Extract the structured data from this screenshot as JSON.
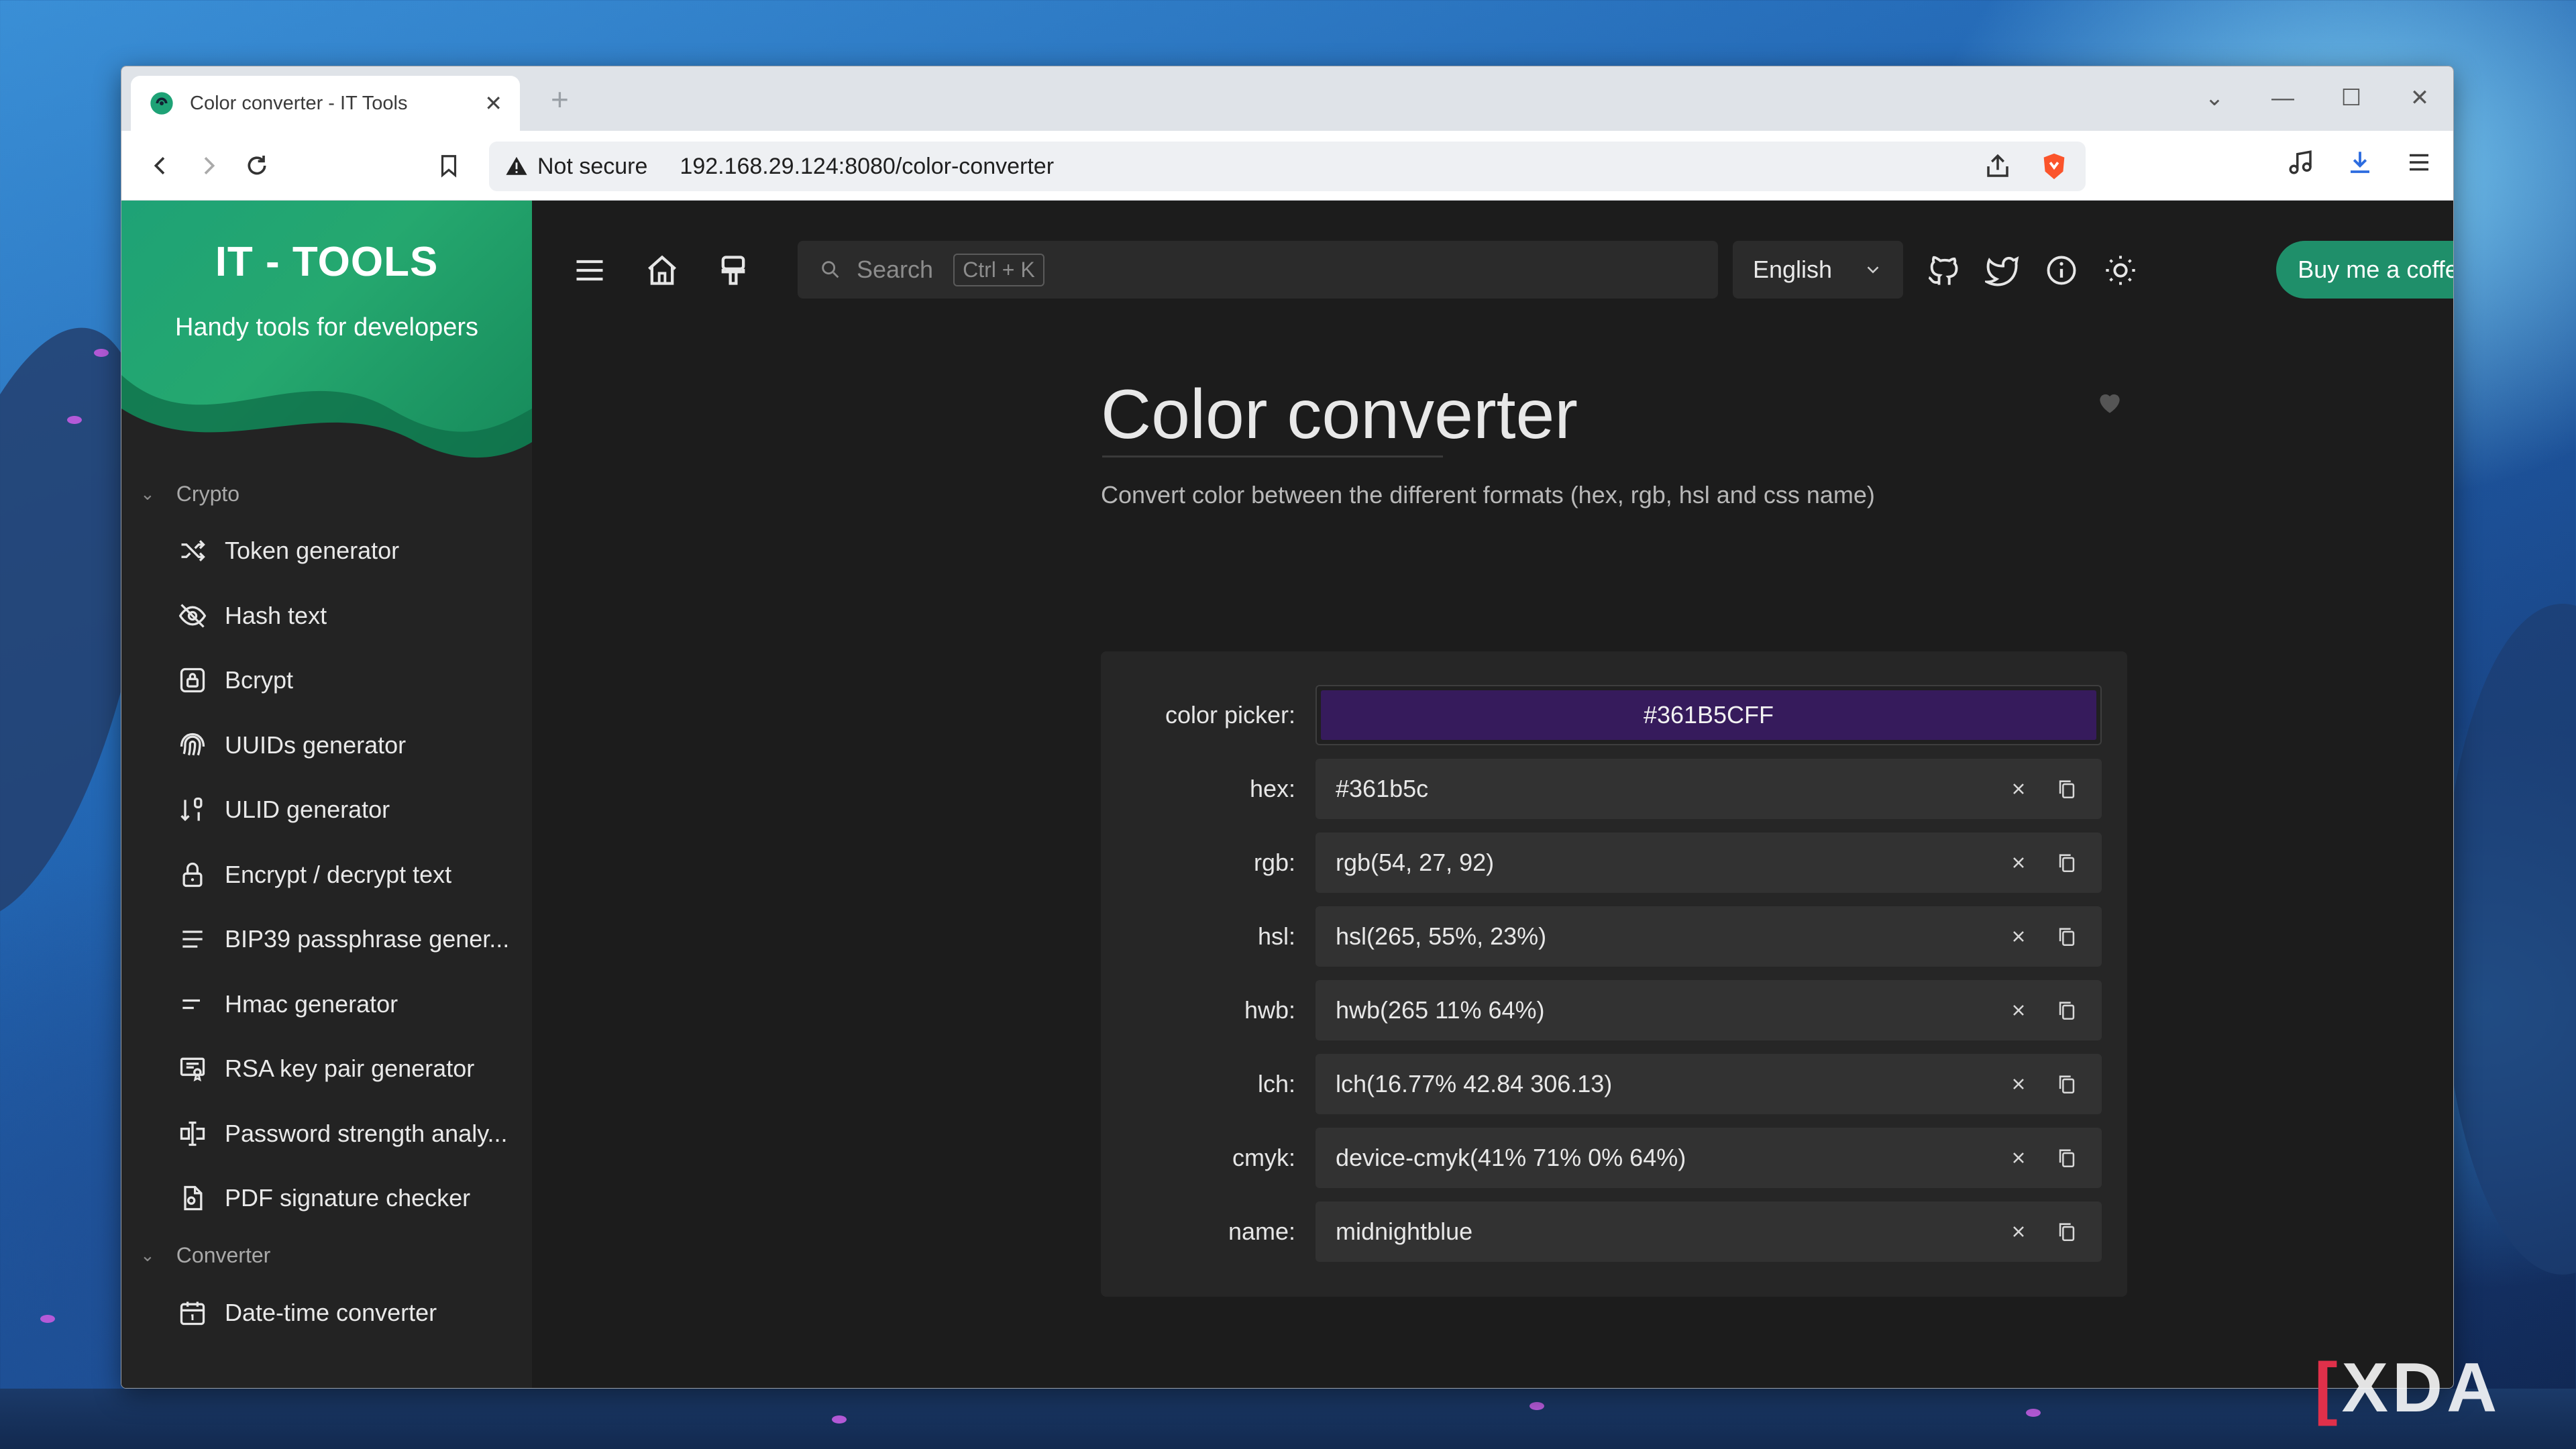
{
  "browser": {
    "tab_title": "Color converter - IT Tools",
    "security_label": "Not secure",
    "url": "192.168.29.124:8080/color-converter"
  },
  "sidebar": {
    "brand_title": "IT - TOOLS",
    "brand_subtitle": "Handy tools for developers",
    "sections": [
      {
        "label": "Crypto",
        "items": [
          {
            "label": "Token generator",
            "icon": "shuffle-icon"
          },
          {
            "label": "Hash text",
            "icon": "eye-off-icon"
          },
          {
            "label": "Bcrypt",
            "icon": "lock-square-icon"
          },
          {
            "label": "UUIDs generator",
            "icon": "fingerprint-icon"
          },
          {
            "label": "ULID generator",
            "icon": "sort-numeric-icon"
          },
          {
            "label": "Encrypt / decrypt text",
            "icon": "lock-icon"
          },
          {
            "label": "BIP39 passphrase gener...",
            "icon": "align-justified-icon"
          },
          {
            "label": "Hmac generator",
            "icon": "short-text-icon"
          },
          {
            "label": "RSA key pair generator",
            "icon": "certificate-icon"
          },
          {
            "label": "Password strength analy...",
            "icon": "password-icon"
          },
          {
            "label": "PDF signature checker",
            "icon": "file-certificate-icon"
          }
        ]
      },
      {
        "label": "Converter",
        "items": [
          {
            "label": "Date-time converter",
            "icon": "calendar-icon"
          }
        ]
      }
    ]
  },
  "topbar": {
    "search_placeholder": "Search",
    "search_shortcut": "Ctrl + K",
    "language": "English",
    "coffee_label": "Buy me a coffee"
  },
  "page": {
    "title": "Color converter",
    "description": "Convert color between the different formats (hex, rgb, hsl and css name)"
  },
  "converter": {
    "picker_label": "color picker:",
    "picker_value": "#361B5CFF",
    "picker_color": "#361b5c",
    "fields": [
      {
        "label": "hex:",
        "value": "#361b5c"
      },
      {
        "label": "rgb:",
        "value": "rgb(54, 27, 92)"
      },
      {
        "label": "hsl:",
        "value": "hsl(265, 55%, 23%)"
      },
      {
        "label": "hwb:",
        "value": "hwb(265 11% 64%)"
      },
      {
        "label": "lch:",
        "value": "lch(16.77% 42.84 306.13)"
      },
      {
        "label": "cmyk:",
        "value": "device-cmyk(41% 71% 0% 64%)"
      },
      {
        "label": "name:",
        "value": "midnightblue"
      }
    ]
  },
  "watermark": "XDA",
  "colors": {
    "accent": "#1f8f6a",
    "brand_gradient_start": "#1ea276",
    "brand_gradient_end": "#16895a",
    "app_background": "#1c1c1c"
  }
}
